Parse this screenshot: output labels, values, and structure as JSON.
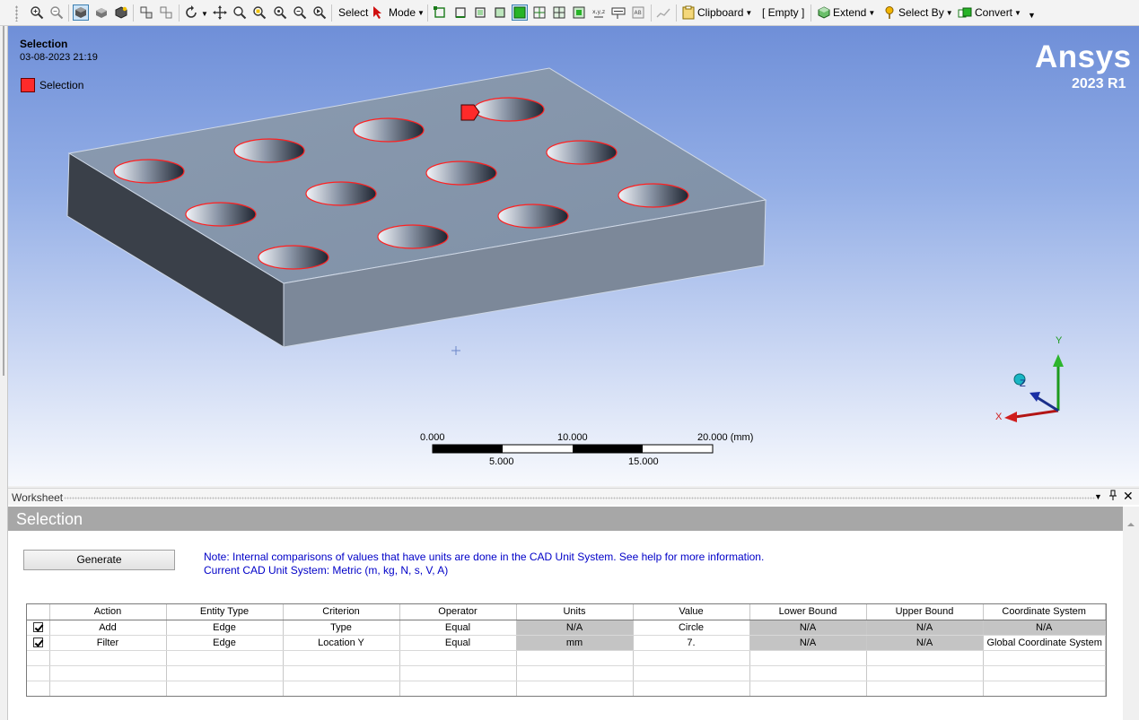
{
  "toolbar": {
    "select_label": "Select",
    "mode_label": "Mode",
    "clipboard_label": "Clipboard",
    "empty_label": "[ Empty ]",
    "extend_label": "Extend",
    "select_by_label": "Select By",
    "convert_label": "Convert"
  },
  "viewport": {
    "title": "Selection",
    "date": "03-08-2023 21:19",
    "legend_label": "Selection",
    "legend_color": "#ff2a2a",
    "brand_name": "Ansys",
    "brand_version": "2023 R1",
    "scale": {
      "top_labels": [
        "0.000",
        "10.000",
        "20.000 (mm)"
      ],
      "bottom_labels": [
        "5.000",
        "15.000"
      ]
    },
    "triad": {
      "x_label": "X",
      "y_label": "Y",
      "z_label": "Z"
    }
  },
  "worksheet": {
    "panel_title": "Worksheet",
    "section_title": "Selection",
    "generate_label": "Generate",
    "note_line1": "Note: Internal comparisons of values that have units are done in the CAD Unit System. See help for more information.",
    "note_line2": "Current CAD Unit System:  Metric (m, kg, N, s, V, A)",
    "columns": [
      "Action",
      "Entity Type",
      "Criterion",
      "Operator",
      "Units",
      "Value",
      "Lower Bound",
      "Upper Bound",
      "Coordinate System"
    ],
    "rows": [
      {
        "checked": true,
        "action": "Add",
        "entity_type": "Edge",
        "criterion": "Type",
        "operator": "Equal",
        "units": "N/A",
        "value": "Circle",
        "lower_bound": "N/A",
        "upper_bound": "N/A",
        "coordinate_system": "N/A"
      },
      {
        "checked": true,
        "action": "Filter",
        "entity_type": "Edge",
        "criterion": "Location Y",
        "operator": "Equal",
        "units": "mm",
        "value": "7.",
        "lower_bound": "N/A",
        "upper_bound": "N/A",
        "coordinate_system": "Global Coordinate System"
      }
    ]
  }
}
